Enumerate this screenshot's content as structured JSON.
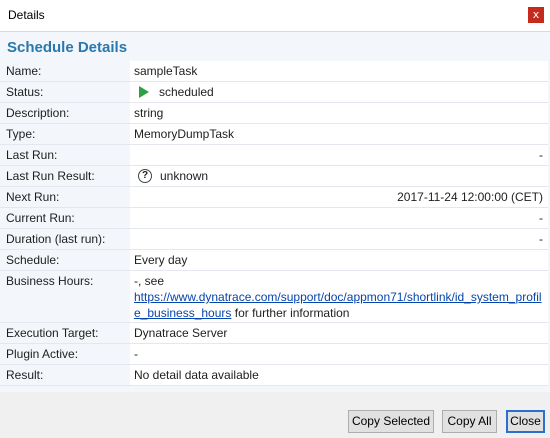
{
  "window": {
    "title": "Details",
    "close_glyph": "x"
  },
  "heading": "Schedule Details",
  "rows": [
    {
      "label": "Name:",
      "value": "sampleTask"
    },
    {
      "label": "Status:",
      "value": "scheduled",
      "icon": "play-icon",
      "icon_color": "#2ea043"
    },
    {
      "label": "Description:",
      "value": "string"
    },
    {
      "label": "Type:",
      "value": "MemoryDumpTask"
    },
    {
      "label": "Last Run:",
      "value": "-"
    },
    {
      "label": "Last Run Result:",
      "value": "unknown",
      "icon": "question-circle-icon",
      "icon_glyph": "?"
    },
    {
      "label": "Next Run:",
      "value": "2017-11-24 12:00:00 (CET)"
    },
    {
      "label": "Current Run:",
      "value": "-"
    },
    {
      "label": "Duration (last run):",
      "value": "-"
    },
    {
      "label": "Schedule:",
      "value": "Every day"
    },
    {
      "label": "Business Hours:",
      "value_prefix": "-, see",
      "link": "https://www.dynatrace.com/support/doc/appmon71/shortlink/id_system_profile_business_hours",
      "value_suffix": " for further information"
    },
    {
      "label": "Execution Target:",
      "value": "Dynatrace Server"
    },
    {
      "label": "Plugin Active:",
      "value": "-"
    },
    {
      "label": "Result:",
      "value": "No detail data available"
    }
  ],
  "buttons": {
    "copy_selected": "Copy Selected",
    "copy_all": "Copy All",
    "close": "Close"
  },
  "colors": {
    "accent": "#2a78ae",
    "close_red": "#c42b1c",
    "link": "#0645ad"
  }
}
